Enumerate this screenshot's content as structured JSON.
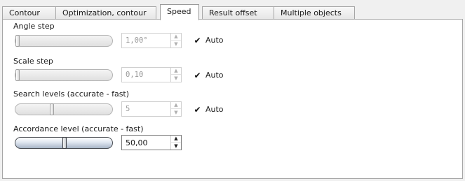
{
  "tabs": [
    {
      "label": "Contour"
    },
    {
      "label": "Optimization, contour"
    },
    {
      "label": "Speed"
    },
    {
      "label": "Result offset"
    },
    {
      "label": "Multiple objects"
    }
  ],
  "active_tab": "Speed",
  "settings": {
    "angle_step": {
      "label": "Angle step",
      "value": "1,00°",
      "auto_label": "Auto",
      "auto": true,
      "enabled": false,
      "slider_fraction": 0.0
    },
    "scale_step": {
      "label": "Scale step",
      "value": "0,10",
      "auto_label": "Auto",
      "auto": true,
      "enabled": false,
      "slider_fraction": 0.0
    },
    "search_levels": {
      "label": "Search levels (accurate - fast)",
      "value": "5",
      "auto_label": "Auto",
      "auto": true,
      "enabled": false,
      "slider_fraction": 0.37
    },
    "accordance_level": {
      "label": "Accordance level (accurate - fast)",
      "value": "50,00",
      "enabled": true,
      "slider_fraction": 0.5
    }
  },
  "icons": {
    "up": "▲",
    "down": "▼",
    "check": "✔"
  }
}
